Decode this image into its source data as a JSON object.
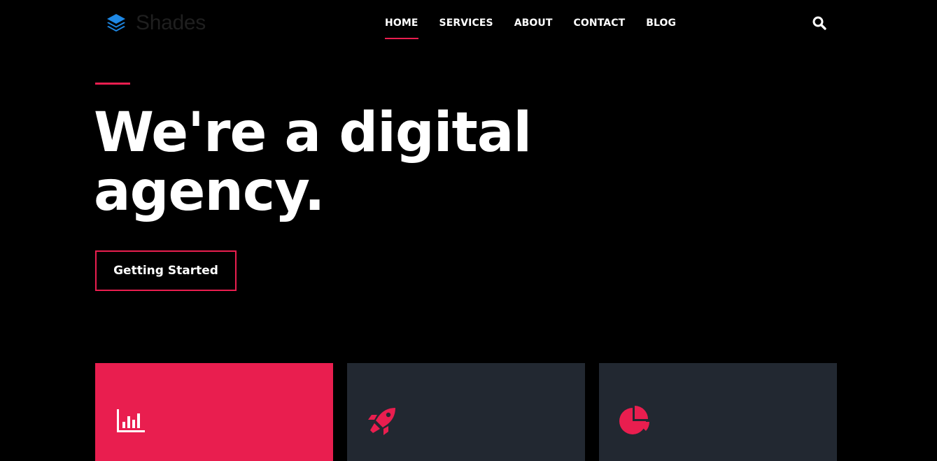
{
  "brand": {
    "name": "Shades",
    "logo_icon": "layers-icon",
    "logo_color": "#1e88e5"
  },
  "nav": {
    "items": [
      {
        "label": "HOME",
        "active": true
      },
      {
        "label": "SERVICES",
        "active": false
      },
      {
        "label": "ABOUT",
        "active": false
      },
      {
        "label": "CONTACT",
        "active": false
      },
      {
        "label": "BLOG",
        "active": false
      }
    ],
    "search_icon": "search-icon"
  },
  "hero": {
    "title_line_1": "We're a digital",
    "title_line_2": "agency.",
    "cta_label": "Getting Started"
  },
  "cards": [
    {
      "icon": "bar-chart-icon",
      "background": "#e91e4f"
    },
    {
      "icon": "rocket-icon",
      "background": "#222831"
    },
    {
      "icon": "pie-chart-icon",
      "background": "#222831"
    }
  ],
  "colors": {
    "accent": "#e91e4f",
    "background": "#000000",
    "card_dark": "#222831"
  }
}
